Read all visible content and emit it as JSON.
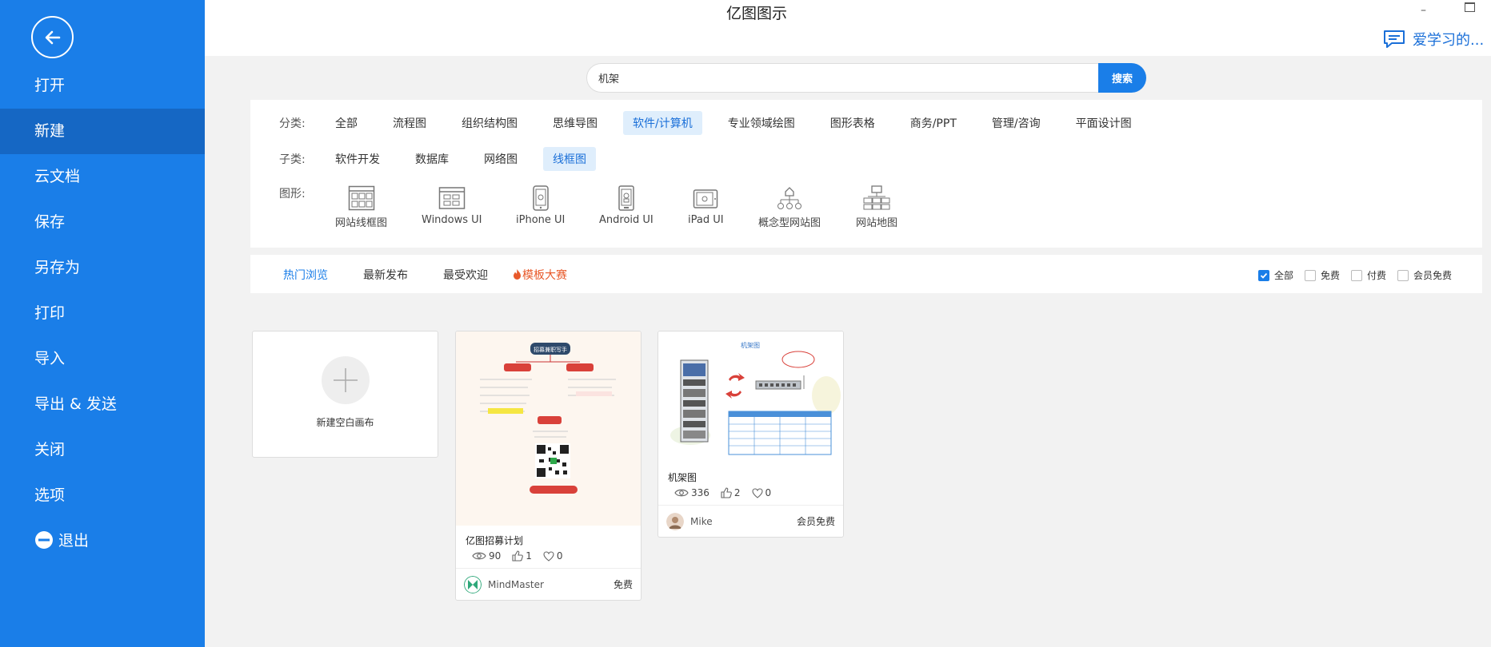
{
  "app": {
    "title": "亿图图示"
  },
  "window": {
    "minimize": "–"
  },
  "user": {
    "name": "爱学习的..."
  },
  "sidebar": {
    "items": [
      {
        "label": "打开"
      },
      {
        "label": "新建"
      },
      {
        "label": "云文档"
      },
      {
        "label": "保存"
      },
      {
        "label": "另存为"
      },
      {
        "label": "打印"
      },
      {
        "label": "导入"
      },
      {
        "label": "导出 & 发送"
      },
      {
        "label": "关闭"
      },
      {
        "label": "选项"
      },
      {
        "label": "退出"
      }
    ],
    "active_index": 1
  },
  "search": {
    "value": "机架",
    "button": "搜索"
  },
  "filters": {
    "category_label": "分类:",
    "categories": [
      "全部",
      "流程图",
      "组织结构图",
      "思维导图",
      "软件/计算机",
      "专业领域绘图",
      "图形表格",
      "商务/PPT",
      "管理/咨询",
      "平面设计图"
    ],
    "category_active": 4,
    "sub_label": "子类:",
    "subcategories": [
      "软件开发",
      "数据库",
      "网络图",
      "线框图"
    ],
    "sub_active": 3,
    "shapes_label": "图形:",
    "shapes": [
      {
        "label": "网站线框图",
        "icon": "website-wireframe-icon"
      },
      {
        "label": "Windows UI",
        "icon": "windows-ui-icon"
      },
      {
        "label": "iPhone UI",
        "icon": "iphone-ui-icon"
      },
      {
        "label": "Android UI",
        "icon": "android-ui-icon"
      },
      {
        "label": "iPad UI",
        "icon": "ipad-ui-icon"
      },
      {
        "label": "概念型网站图",
        "icon": "concept-site-icon"
      },
      {
        "label": "网站地图",
        "icon": "sitemap-icon"
      }
    ]
  },
  "tabs": {
    "items": [
      "热门浏览",
      "最新发布",
      "最受欢迎",
      "模板大赛"
    ],
    "active": 0
  },
  "price_filter": [
    {
      "label": "全部",
      "checked": true
    },
    {
      "label": "免费",
      "checked": false
    },
    {
      "label": "付费",
      "checked": false
    },
    {
      "label": "会员免费",
      "checked": false
    }
  ],
  "new_card": {
    "label": "新建空白画布"
  },
  "templates": [
    {
      "title": "亿图招募计划",
      "views": "90",
      "likes": "1",
      "favorites": "0",
      "author": "MindMaster",
      "price": "免费",
      "thumb": {
        "header": "招募兼职写手",
        "left_node": "",
        "right_node": "",
        "bottom_node": "",
        "footer": ""
      }
    },
    {
      "title": "机架图",
      "views": "336",
      "likes": "2",
      "favorites": "0",
      "author": "Mike",
      "price": "会员免费",
      "thumb": {
        "header": "机架图"
      }
    }
  ],
  "colors": {
    "sidebar": "#1a7ee8",
    "sidebar_active": "#1567c4",
    "accent": "#1a7ee8",
    "fire": "#e8592a"
  }
}
